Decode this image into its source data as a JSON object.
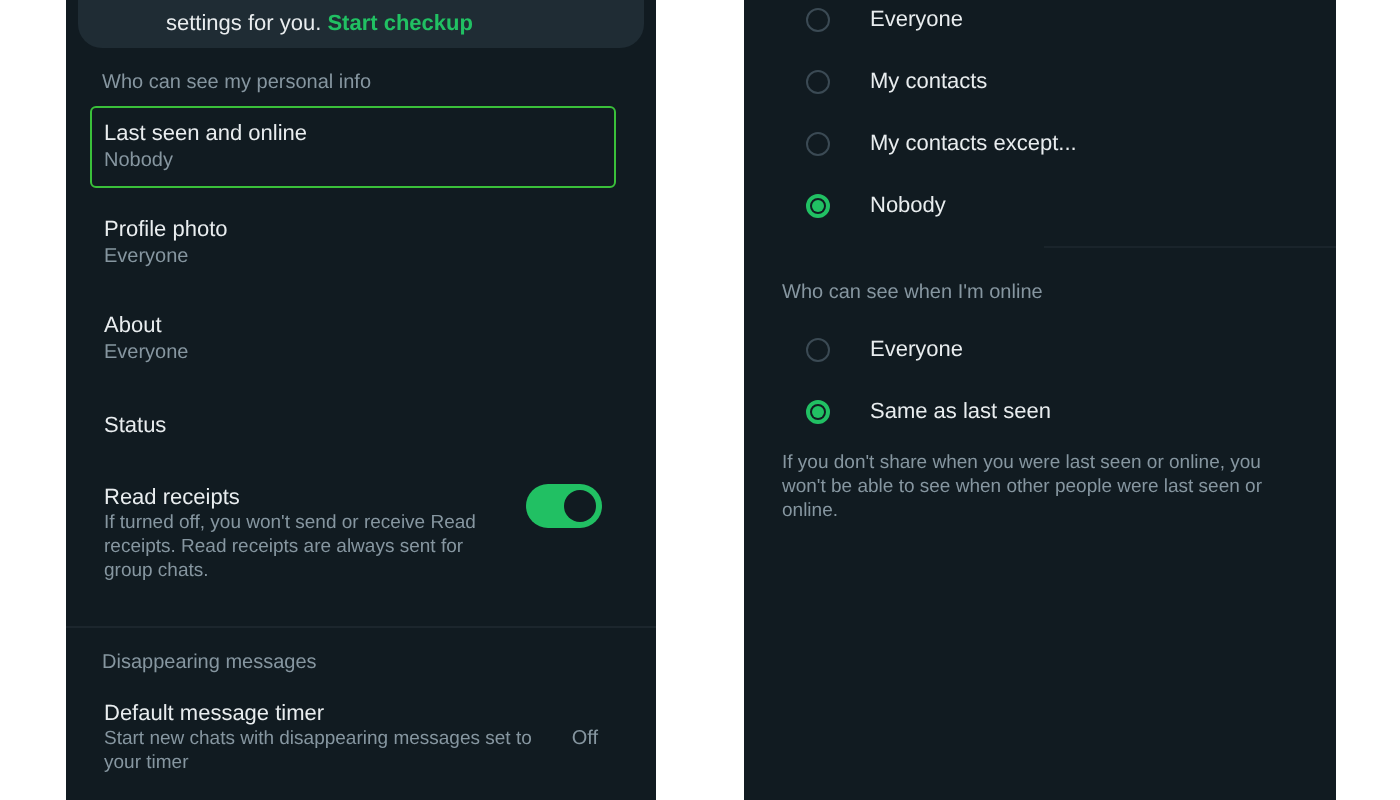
{
  "left_panel": {
    "checkup_card": {
      "text": "settings for you.",
      "link": "Start checkup"
    },
    "sections": [
      {
        "header": "Who can see my personal info",
        "items": [
          {
            "kind": "setting",
            "title": "Last seen and online",
            "subtitle": "Nobody",
            "selected": true
          },
          {
            "kind": "setting",
            "title": "Profile photo",
            "subtitle": "Everyone",
            "selected": false
          },
          {
            "kind": "setting",
            "title": "About",
            "subtitle": "Everyone",
            "selected": false
          },
          {
            "kind": "setting",
            "title": "Status",
            "selected": false
          },
          {
            "kind": "toggle",
            "title": "Read receipts",
            "description": "If turned off, you won't send or receive Read receipts. Read receipts are always sent for group chats.",
            "on": true
          }
        ]
      },
      {
        "header": "Disappearing messages",
        "items": [
          {
            "kind": "trailing",
            "title": "Default message timer",
            "description": "Start new chats with disappearing messages set to your timer",
            "value": "Off"
          }
        ]
      }
    ]
  },
  "right_panel": {
    "last_seen_options": [
      {
        "label": "Everyone",
        "selected": false
      },
      {
        "label": "My contacts",
        "selected": false
      },
      {
        "label": "My contacts except...",
        "selected": false
      },
      {
        "label": "Nobody",
        "selected": true
      }
    ],
    "online_section": {
      "header": "Who can see when I'm online",
      "options": [
        {
          "label": "Everyone",
          "selected": false
        },
        {
          "label": "Same as last seen",
          "selected": true
        }
      ]
    },
    "note": "If you don't share when you were last seen or online, you won't be able to see when other people were last seen or online."
  }
}
